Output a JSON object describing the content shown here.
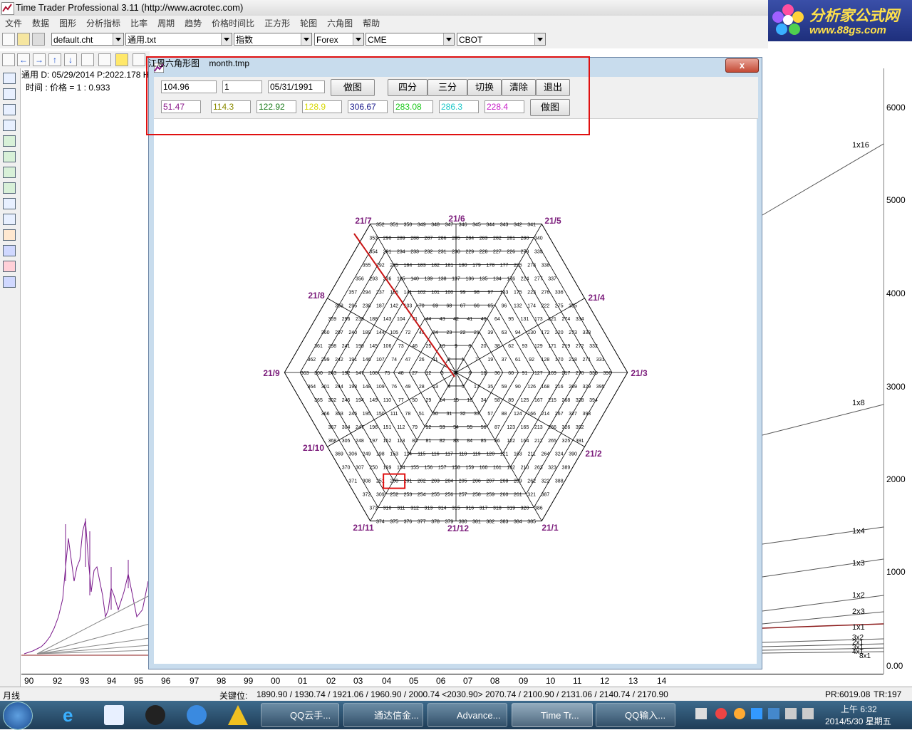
{
  "app": {
    "title": "Time Trader Professional 3.11 (http://www.acrotec.com)",
    "menus": [
      "文件",
      "数据",
      "图形",
      "分析指标",
      "比率",
      "周期",
      "趋势",
      "价格时间比",
      "正方形",
      "轮图",
      "六角图",
      "帮助"
    ]
  },
  "logo": {
    "line1": "分析家公式网",
    "line2": "www.88gs.com"
  },
  "toolbar": {
    "combos": [
      "default.cht",
      "通用.txt",
      "指数",
      "Forex",
      "CME",
      "CBOT"
    ]
  },
  "chart_info": {
    "line1": "通用  D: 05/29/2014  P:2022.178  H",
    "line2": "时间 : 价格  = 1 :    0.933"
  },
  "right_axis": [
    "6000",
    "5000",
    "4000",
    "3000",
    "2000",
    "1000",
    "0.00"
  ],
  "gann_labels": [
    "1x16",
    "1x8",
    "1x4",
    "1x3",
    "1x2",
    "2x3",
    "1x1",
    "3x2",
    "2x1",
    "3x1",
    "4x1",
    "8x1"
  ],
  "dialog": {
    "title": "江恩六角形图",
    "subtitle": "month.tmp",
    "close_label": "x",
    "row1_inputs": [
      "104.96",
      "1",
      "05/31/1991"
    ],
    "row1_buttons": [
      "做图",
      "四分",
      "三分",
      "切换",
      "清除",
      "退出"
    ],
    "row2_values": [
      {
        "text": "51.47",
        "color": "#8b1a8b"
      },
      {
        "text": "114.3",
        "color": "#8b8b00"
      },
      {
        "text": "122.92",
        "color": "#1a7a1a"
      },
      {
        "text": "128.9",
        "color": "#d8d800"
      },
      {
        "text": "306.67",
        "color": "#1a1a8b"
      },
      {
        "text": "283.08",
        "color": "#1ac81a"
      },
      {
        "text": "286.3",
        "color": "#1ac8c8"
      },
      {
        "text": "228.4",
        "color": "#c81ac8"
      }
    ],
    "row2_button": "做图"
  },
  "hexagon": {
    "corner_labels": [
      "21/7",
      "21/6",
      "21/5",
      "21/8",
      "21/4",
      "21/9",
      "21/3",
      "21/10",
      "21/2",
      "21/11",
      "21/12",
      "21/1"
    ],
    "highlight": "200",
    "rows": [
      [
        "352",
        "351",
        "350",
        "349",
        "348",
        "347",
        "346",
        "345",
        "344",
        "343",
        "342",
        "341"
      ],
      [
        "353",
        "290",
        "289",
        "288",
        "287",
        "286",
        "285",
        "284",
        "283",
        "282",
        "281",
        "280",
        "340"
      ],
      [
        "354",
        "291",
        "234",
        "233",
        "232",
        "231",
        "230",
        "229",
        "228",
        "227",
        "226",
        "279",
        "339"
      ],
      [
        "355",
        "292",
        "235",
        "184",
        "183",
        "182",
        "181",
        "180",
        "179",
        "178",
        "177",
        "225",
        "278",
        "338"
      ],
      [
        "356",
        "293",
        "236",
        "185",
        "140",
        "139",
        "138",
        "137",
        "136",
        "135",
        "134",
        "176",
        "224",
        "277",
        "337"
      ],
      [
        "357",
        "294",
        "237",
        "186",
        "141",
        "102",
        "101",
        "100",
        "99",
        "98",
        "97",
        "133",
        "175",
        "223",
        "276",
        "336"
      ],
      [
        "358",
        "295",
        "238",
        "187",
        "142",
        "103",
        "70",
        "69",
        "68",
        "67",
        "66",
        "65",
        "96",
        "132",
        "174",
        "222",
        "275",
        "335"
      ],
      [
        "359",
        "296",
        "239",
        "188",
        "143",
        "104",
        "71",
        "44",
        "43",
        "42",
        "41",
        "40",
        "64",
        "95",
        "131",
        "173",
        "221",
        "274",
        "334"
      ],
      [
        "360",
        "297",
        "240",
        "189",
        "144",
        "105",
        "72",
        "45",
        "24",
        "23",
        "22",
        "21",
        "39",
        "63",
        "94",
        "130",
        "172",
        "220",
        "273",
        "333"
      ],
      [
        "361",
        "298",
        "241",
        "190",
        "145",
        "106",
        "73",
        "46",
        "25",
        "10",
        "9",
        "8",
        "20",
        "38",
        "62",
        "93",
        "129",
        "171",
        "219",
        "272",
        "332"
      ],
      [
        "362",
        "299",
        "242",
        "191",
        "146",
        "107",
        "74",
        "47",
        "26",
        "11",
        "2",
        "1",
        "7",
        "19",
        "37",
        "61",
        "92",
        "128",
        "170",
        "218",
        "271",
        "331"
      ],
      [
        "363",
        "300",
        "243",
        "192",
        "147",
        "108",
        "75",
        "48",
        "27",
        "12",
        "3",
        "0",
        "6",
        "18",
        "36",
        "60",
        "91",
        "127",
        "169",
        "217",
        "270",
        "330",
        "396"
      ],
      [
        "364",
        "301",
        "244",
        "193",
        "148",
        "109",
        "76",
        "49",
        "28",
        "13",
        "4",
        "5",
        "17",
        "35",
        "59",
        "90",
        "126",
        "168",
        "216",
        "269",
        "329",
        "395"
      ],
      [
        "365",
        "302",
        "245",
        "194",
        "149",
        "110",
        "77",
        "50",
        "29",
        "14",
        "15",
        "16",
        "34",
        "58",
        "89",
        "125",
        "167",
        "215",
        "268",
        "328",
        "394"
      ],
      [
        "366",
        "303",
        "246",
        "195",
        "150",
        "111",
        "78",
        "51",
        "30",
        "31",
        "32",
        "33",
        "57",
        "88",
        "124",
        "166",
        "214",
        "267",
        "327",
        "393"
      ],
      [
        "367",
        "304",
        "247",
        "196",
        "151",
        "112",
        "79",
        "52",
        "53",
        "54",
        "55",
        "56",
        "87",
        "123",
        "165",
        "213",
        "266",
        "326",
        "392"
      ],
      [
        "368",
        "305",
        "248",
        "197",
        "152",
        "113",
        "80",
        "81",
        "82",
        "83",
        "84",
        "85",
        "86",
        "122",
        "164",
        "212",
        "265",
        "325",
        "391"
      ],
      [
        "369",
        "306",
        "249",
        "198",
        "153",
        "114",
        "115",
        "116",
        "117",
        "118",
        "119",
        "120",
        "121",
        "163",
        "211",
        "264",
        "324",
        "390"
      ],
      [
        "370",
        "307",
        "250",
        "199",
        "154",
        "155",
        "156",
        "157",
        "158",
        "159",
        "160",
        "161",
        "162",
        "210",
        "263",
        "323",
        "389"
      ],
      [
        "371",
        "308",
        "251",
        "200",
        "201",
        "202",
        "203",
        "204",
        "205",
        "206",
        "207",
        "208",
        "209",
        "262",
        "322",
        "388"
      ],
      [
        "372",
        "309",
        "252",
        "253",
        "254",
        "255",
        "256",
        "257",
        "258",
        "259",
        "260",
        "261",
        "321",
        "387"
      ],
      [
        "373",
        "310",
        "311",
        "312",
        "313",
        "314",
        "315",
        "316",
        "317",
        "318",
        "319",
        "320",
        "386"
      ],
      [
        "374",
        "375",
        "376",
        "377",
        "378",
        "379",
        "380",
        "381",
        "382",
        "383",
        "384",
        "385"
      ]
    ]
  },
  "x_axis": [
    "90",
    "92",
    "93",
    "94",
    "95",
    "96",
    "97",
    "98",
    "99",
    "00",
    "01",
    "02",
    "03",
    "04",
    "05",
    "06",
    "07",
    "08",
    "09",
    "10",
    "11",
    "12",
    "13",
    "14"
  ],
  "status": {
    "left": "月线",
    "key_label": "关键位:",
    "key_values": "1890.90 / 1930.74 / 1921.06 / 1960.90 / 2000.74 <2030.90> 2070.74 / 2100.90 / 2131.06 / 2140.74 / 2170.90",
    "pr": "PR:6019.08",
    "tr": "TR:197"
  },
  "taskbar": {
    "buttons": [
      "QQ云手...",
      "通达信金...",
      "Advance...",
      "Time Tr...",
      "QQ输入..."
    ],
    "time": "上午 6:32",
    "date": "2014/5/30 星期五"
  }
}
